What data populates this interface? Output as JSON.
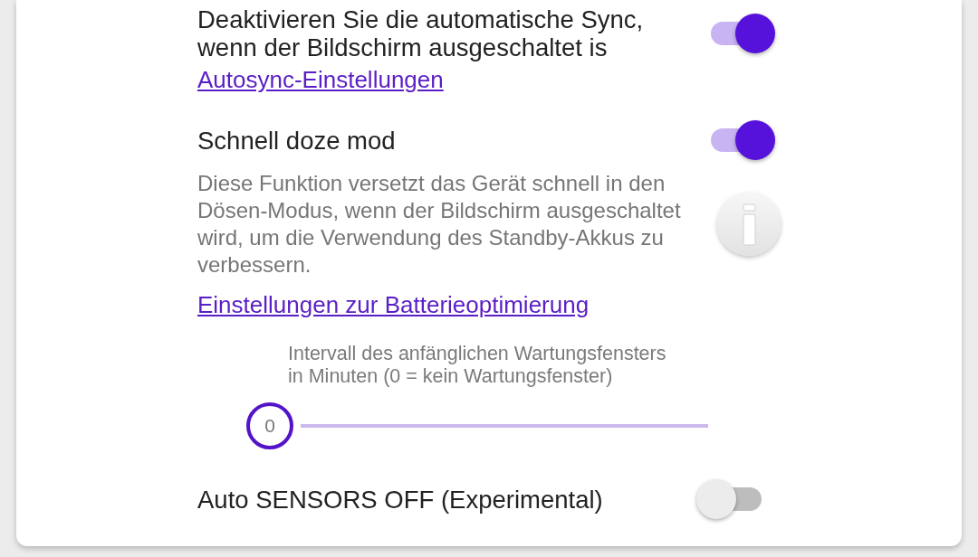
{
  "sync_toggle": {
    "label": "Deaktivieren Sie die automatische Sync, wenn der Bildschirm ausgeschaltet is",
    "on": true
  },
  "autosync_link": "Autosync-Einstellungen",
  "doze_toggle": {
    "label": "Schnell doze mod",
    "on": true
  },
  "doze_description": "Diese Funktion versetzt das Gerät schnell in den Dösen-Modus, wenn der Bildschirm ausgeschaltet wird, um die Verwendung des Standby-Akkus zu verbessern.",
  "battery_link": "Einstellungen zur Batterieoptimierung",
  "maintenance_slider": {
    "label": "Intervall des anfänglichen Wartungsfensters in Minuten (0 = kein Wartungsfenster)",
    "value": "0",
    "level": 0
  },
  "sensors_toggle": {
    "label": "Auto SENSORS OFF (Experimental)",
    "on": false
  }
}
